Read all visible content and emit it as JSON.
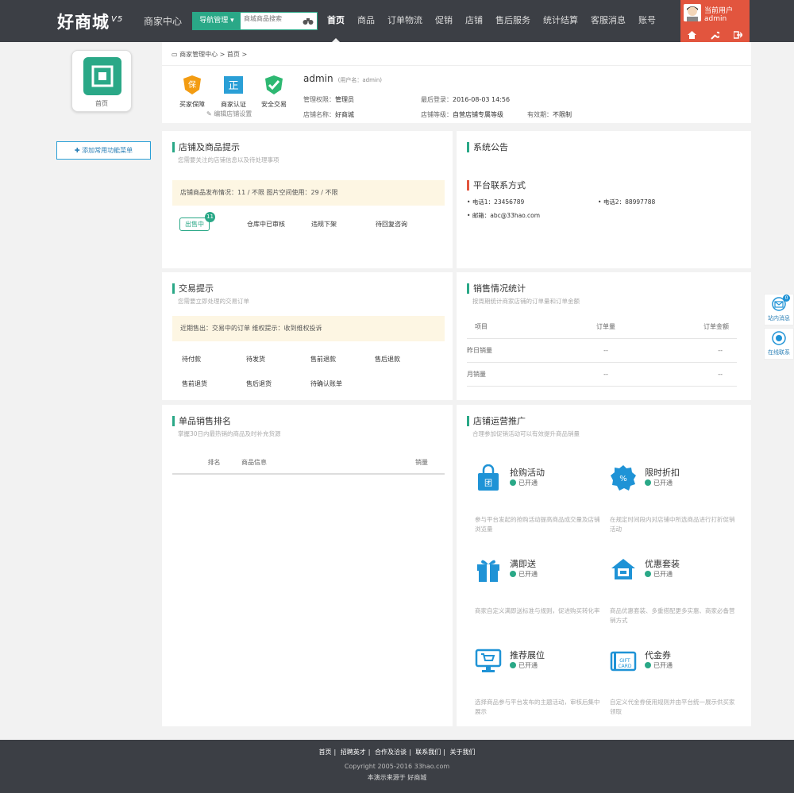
{
  "header": {
    "logo": "好商城",
    "logo_version": "V5",
    "merchant_center": "商家中心",
    "nav_manage": "导航管理",
    "search_placeholder": "商城商品搜索",
    "nav": [
      "首页",
      "商品",
      "订单物流",
      "促销",
      "店铺",
      "售后服务",
      "统计结算",
      "客服消息",
      "账号"
    ],
    "user_role": "当前用户",
    "user_name": "admin"
  },
  "sidebar": {
    "home_label": "首页",
    "add_menu": "添加常用功能菜单"
  },
  "breadcrumb": {
    "root": "商家管理中心",
    "sep": ">",
    "current": "首页",
    "sep2": ">"
  },
  "profile": {
    "badges": [
      "买家保障",
      "商家认证",
      "安全交易"
    ],
    "edit": "编辑店铺设置",
    "name": "admin",
    "account": "(用户名：admin)",
    "role_label": "管理权限：",
    "role": "管理员",
    "last_login_label": "最后登录：",
    "last_login": "2016-08-03 14:56",
    "store_label": "店铺名称：",
    "store": "好商城",
    "level_label": "店铺等级：",
    "level": "自营店铺专属等级",
    "expire_label": "有效期：",
    "expire": "不限制"
  },
  "store_tips": {
    "title": "店铺及商品提示",
    "sub": "您需要关注的店铺信息以及待处理事项",
    "notice": "店铺商品发布情况：11 /  不限      图片空间使用：29 / 不限",
    "on_sale": "出售中",
    "on_sale_count": "11",
    "items": [
      "仓库中已审核",
      "违规下架",
      "待回复咨询"
    ]
  },
  "announce": {
    "title": "系统公告",
    "contact_title": "平台联系方式",
    "phone1": "电话1：23456789",
    "phone2": "电话2：88997788",
    "email": "邮箱：abc@33hao.com"
  },
  "trade": {
    "title": "交易提示",
    "sub": "您需要立即处理的交易订单",
    "notice": "近期售出：交易中的订单      维权提示：收到维权投诉",
    "items": [
      "待付款",
      "待发货",
      "售前退款",
      "售后退款",
      "售前退货",
      "售后退货",
      "待确认账单"
    ]
  },
  "sales_stat": {
    "title": "销售情况统计",
    "sub": "按周期统计商家店铺的订单量和订单金额",
    "headers": [
      "项目",
      "订单量",
      "订单金额"
    ],
    "rows": [
      [
        "昨日销量",
        "--",
        "--"
      ],
      [
        "月销量",
        "--",
        "--"
      ]
    ]
  },
  "ranking": {
    "title": "单品销售排名",
    "sub": "掌握30日内最热销的商品及时补充货源",
    "headers": [
      "排名",
      "商品信息",
      "销量"
    ]
  },
  "promo": {
    "title": "店铺运营推广",
    "sub": "合理参加促销活动可以有效提升商品销量",
    "status": "已开通",
    "items": [
      {
        "name": "抢购活动",
        "desc": "参与平台发起的抢购活动提高商品成交量及店铺浏览量"
      },
      {
        "name": "限时折扣",
        "desc": "在规定时间段内对店铺中所选商品进行打折促销活动"
      },
      {
        "name": "满即送",
        "desc": "商家自定义满即送标准与规则，促进购买转化率"
      },
      {
        "name": "优惠套装",
        "desc": "商品优惠套装、多重搭配更多实惠、商家必备营销方式"
      },
      {
        "name": "推荐展位",
        "desc": "选择商品参与平台发布的主题活动，审核后集中展示"
      },
      {
        "name": "代金券",
        "desc": "自定义代金券使用规则并由平台统一展示供买家领取"
      }
    ]
  },
  "floatbar": {
    "msg": "站内消息",
    "msg_count": "0",
    "online": "在线联系"
  },
  "footer": {
    "links": [
      "首页",
      "招聘英才",
      "合作及洽谈",
      "联系我们",
      "关于我们"
    ],
    "copyright": "Copyright 2005-2016 33hao.com",
    "source": "本演示来源于 好商城"
  },
  "colors": {
    "accent": "#2aa887",
    "header": "#3c3f45",
    "user": "#e2553e",
    "promo_icon": "#1f93d6"
  }
}
